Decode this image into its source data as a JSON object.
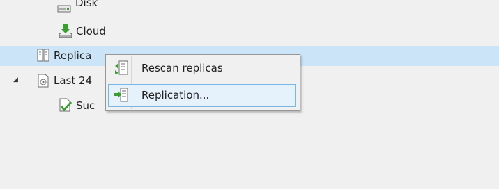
{
  "tree": {
    "items": [
      {
        "label": "Disk",
        "icon": "disk-icon"
      },
      {
        "label": "Cloud",
        "icon": "cloud-icon"
      },
      {
        "label": "Replica",
        "icon": "replica-icon"
      },
      {
        "label": "Last 24",
        "icon": "job-history-icon",
        "expander": "◢"
      },
      {
        "label": "Suc",
        "icon": "success-icon"
      }
    ]
  },
  "context_menu": {
    "items": [
      {
        "label": "Rescan replicas",
        "icon": "rescan-icon"
      },
      {
        "label": "Replication...",
        "icon": "replication-icon"
      }
    ]
  },
  "colors": {
    "selection": "#cce4f7",
    "menu_hover": "#e5f1fb",
    "menu_hover_border": "#7ab7e6",
    "success_green": "#3a9e2f",
    "icon_gray": "#6b6b6b"
  }
}
